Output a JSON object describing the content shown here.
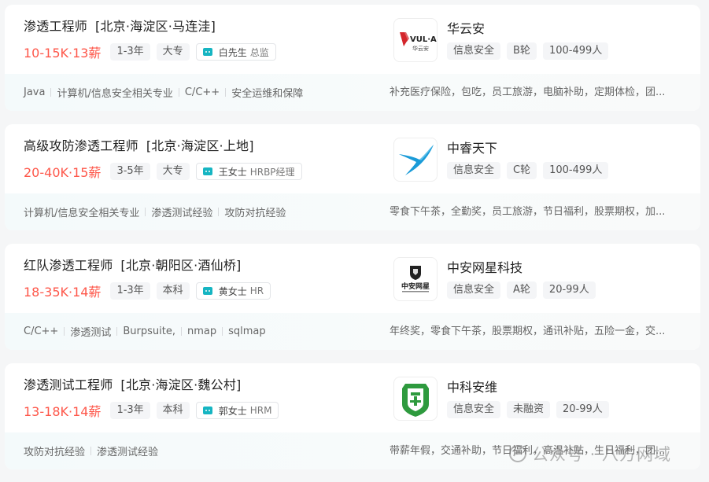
{
  "jobs": [
    {
      "title": "渗透工程师",
      "location": "[北京·海淀区·马连洼]",
      "salary": "10-15K·13薪",
      "experience": "1-3年",
      "education": "大专",
      "recruiter_name": "白先生",
      "recruiter_role": "总监",
      "skills": [
        "Java",
        "计算机/信息安全相关专业",
        "C/C++",
        "安全运维和保障"
      ],
      "company": {
        "name": "华云安",
        "industry": "信息安全",
        "stage": "B轮",
        "size": "100-499人",
        "logo_text": "VUL·AI",
        "logo_subtext": "华云安"
      },
      "benefits": "补充医疗保险，包吃，员工旅游，电脑补助，定期体检，团..."
    },
    {
      "title": "高级攻防渗透工程师",
      "location": "[北京·海淀区·上地]",
      "salary": "20-40K·15薪",
      "experience": "3-5年",
      "education": "大专",
      "recruiter_name": "王女士",
      "recruiter_role": "HRBP经理",
      "skills": [
        "计算机/信息安全相关专业",
        "渗透测试经验",
        "攻防对抗经验"
      ],
      "company": {
        "name": "中睿天下",
        "industry": "信息安全",
        "stage": "C轮",
        "size": "100-499人"
      },
      "benefits": "零食下午茶，全勤奖，员工旅游，节日福利，股票期权，加..."
    },
    {
      "title": "红队渗透工程师",
      "location": "[北京·朝阳区·酒仙桥]",
      "salary": "18-35K·14薪",
      "experience": "1-3年",
      "education": "本科",
      "recruiter_name": "黄女士",
      "recruiter_role": "HR",
      "skills": [
        "C/C++",
        "渗透测试",
        "Burpsuite,",
        "nmap",
        "sqlmap"
      ],
      "company": {
        "name": "中安网星科技",
        "industry": "信息安全",
        "stage": "A轮",
        "size": "20-99人",
        "logo_text": "中安网星"
      },
      "benefits": "年终奖，零食下午茶，股票期权，通讯补贴，五险一金，交..."
    },
    {
      "title": "渗透测试工程师",
      "location": "[北京·海淀区·魏公村]",
      "salary": "13-18K·14薪",
      "experience": "1-3年",
      "education": "本科",
      "recruiter_name": "郭女士",
      "recruiter_role": "HRM",
      "skills": [
        "攻防对抗经验",
        "渗透测试经验"
      ],
      "company": {
        "name": "中科安维",
        "industry": "信息安全",
        "stage": "未融资",
        "size": "20-99人"
      },
      "benefits": "带薪年假，交通补助，节日福利，高温补贴，生日福利，团..."
    }
  ],
  "watermark": {
    "text": "公众号 · 八方网域"
  },
  "colors": {
    "salary": "#fe574a",
    "accent": "#16b5c2",
    "logo_red": "#d4262c",
    "logo_blue": "#1a9bd8",
    "logo_green": "#2e9a3e"
  }
}
